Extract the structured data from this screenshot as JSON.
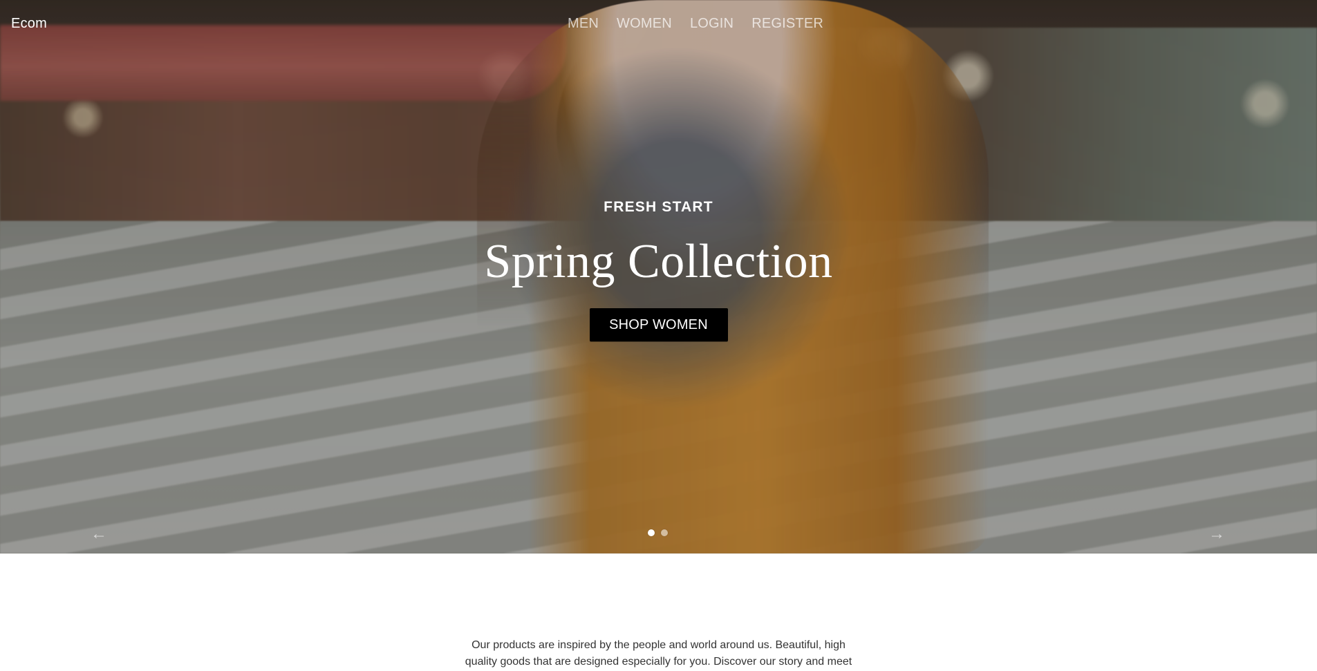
{
  "navbar": {
    "brand": "Ecom",
    "links": [
      "MEN",
      "WOMEN",
      "LOGIN",
      "REGISTER"
    ]
  },
  "hero": {
    "kicker": "FRESH START",
    "headline": "Spring Collection",
    "cta_label": "SHOP WOMEN",
    "controls": {
      "prev_glyph": "←",
      "next_glyph": "→",
      "dots": [
        {
          "active": true
        },
        {
          "active": false
        }
      ]
    }
  },
  "about": {
    "text": "Our products are inspired by the people and world around us. Beautiful, high quality goods that are designed especially for you. Discover our story and meet"
  },
  "icons": {
    "prev": "arrow-left-icon",
    "next": "arrow-right-icon"
  }
}
